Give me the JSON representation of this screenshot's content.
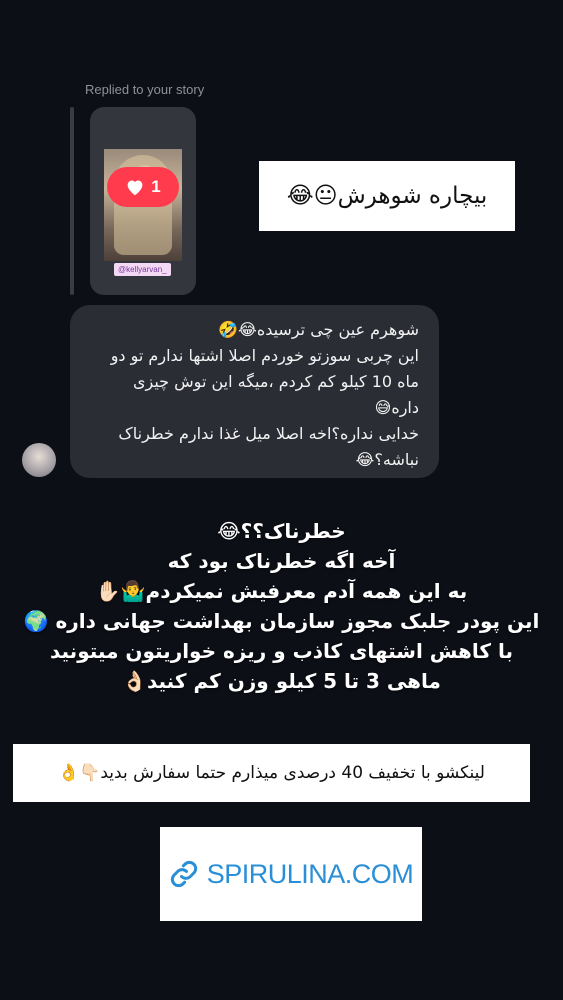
{
  "reply_header": "Replied to your story",
  "story": {
    "like_count": "1",
    "tag": "@kellyarvan_"
  },
  "story_caption": "بیچاره شوهرش😐😂",
  "message": {
    "lines": [
      "شوهرم عین چی ترسیده😂🤣",
      "این چربی سوزتو خوردم اصلا اشتها ندارم تو دو",
      "ماه 10 کیلو کم کردم ،میگه این توش چیزی",
      "داره😅",
      "خدایی نداره؟اخه اصلا میل غذا ندارم خطرناک",
      "نباشه؟😂"
    ]
  },
  "overlay": {
    "lines": [
      "خطرناک؟؟😂",
      "آخه  اگه خطرناک بود که",
      "به این همه آدم معرفیش نمیکردم🤷‍♂️✋🏻",
      "این پودر جلبک مجوز سازمان بهداشت جهانی داره 🌍",
      "با کاهش اشتهای کاذب و ریزه خواریتون میتونید",
      "ماهی 3 تا 5 کیلو وزن کم کنید👌🏻"
    ]
  },
  "promo_text": "لینکشو با تخفیف 40 درصدی میذارم حتما سفارش بدید👇🏻👌",
  "link_label": "SPIRULINA.COM",
  "colors": {
    "background": "#0d0f17",
    "bubble": "#2b2d35",
    "like_badge": "#ff3b4d",
    "link_blue": "#2a8fd6"
  }
}
